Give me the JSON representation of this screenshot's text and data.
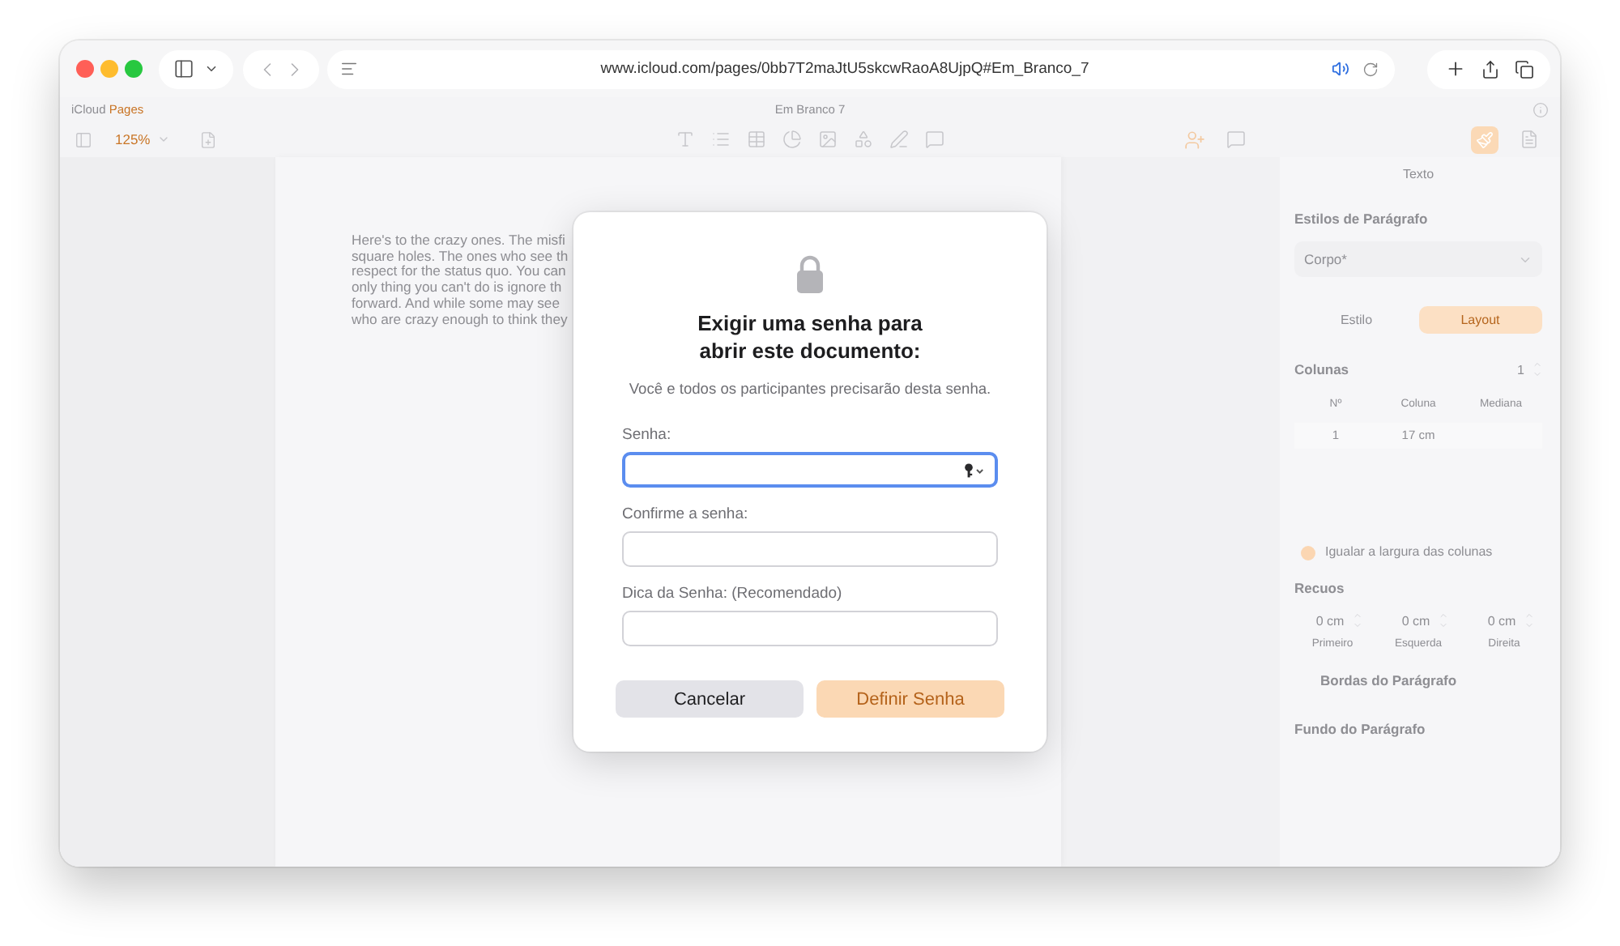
{
  "browser": {
    "url": "www.icloud.com/pages/0bb7T2maJtU5skcwRaoA8UjpQ#Em_Branco_7"
  },
  "app": {
    "brand": "iCloud",
    "app_name": "Pages",
    "document_title": "Em Branco 7",
    "zoom": "125%"
  },
  "document": {
    "lines": [
      "Here's to the crazy ones. The misfi",
      "square holes. The ones who see th",
      "respect for the status quo. You can",
      "only thing you can't do is ignore th",
      "forward. And while some may see",
      "who are crazy enough to think they"
    ]
  },
  "inspector": {
    "tab": "Texto",
    "paragraph_styles": {
      "title": "Estilos de Parágrafo",
      "value": "Corpo*"
    },
    "segments": [
      {
        "label": "Estilo",
        "selected": false
      },
      {
        "label": "Layout",
        "selected": true
      }
    ],
    "columns": {
      "title": "Colunas",
      "value": "1",
      "headers": [
        "Nº",
        "Coluna",
        "Mediana"
      ],
      "rows": [
        {
          "number": "1",
          "width": "17 cm"
        }
      ]
    },
    "equal_width": {
      "label": "Igualar a largura das colunas",
      "checked": true
    },
    "indents": {
      "title": "Recuos",
      "fields": [
        {
          "value": "0 cm",
          "label": "Primeiro"
        },
        {
          "value": "0 cm",
          "label": "Esquerda"
        },
        {
          "value": "0 cm",
          "label": "Direita"
        }
      ]
    },
    "borders": {
      "title": "Bordas do Parágrafo"
    },
    "background": {
      "title": "Fundo do Parágrafo"
    }
  },
  "dialog": {
    "title": "Exigir uma senha para abrir este documento:",
    "message": "Você e todos os participantes precisarão desta senha.",
    "fields": [
      {
        "label": "Senha:",
        "focused": true
      },
      {
        "label": "Confirme a senha:",
        "focused": false
      },
      {
        "label": "Dica da Senha: (Recomendado)",
        "focused": false
      }
    ],
    "buttons": [
      {
        "label": "Cancelar",
        "kind": "secondary",
        "disabled": false
      },
      {
        "label": "Definir Senha",
        "kind": "primary",
        "disabled": true
      }
    ]
  }
}
